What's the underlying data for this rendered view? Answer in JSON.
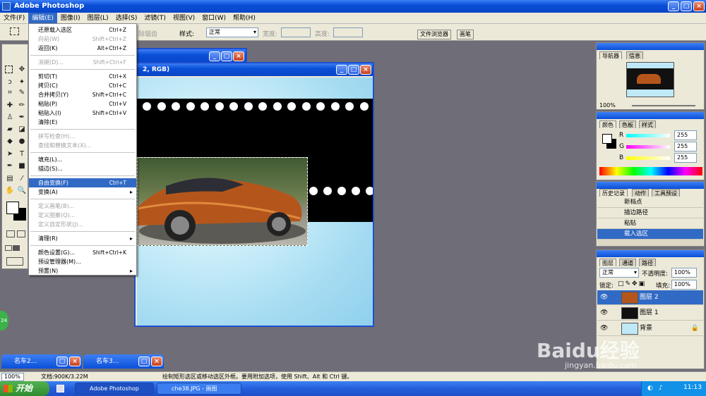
{
  "app": {
    "title": "Adobe Photoshop"
  },
  "menubar": [
    "文件(F)",
    "编辑(E)",
    "图像(I)",
    "图层(L)",
    "选择(S)",
    "滤镜(T)",
    "视图(V)",
    "窗口(W)",
    "帮助(H)"
  ],
  "options": {
    "feather_label": "除锯齿",
    "style_label": "样式:",
    "style_value": "正常",
    "width_label": "宽度:",
    "height_label": "高度:",
    "tabs": [
      "文件浏览器",
      "画笔"
    ]
  },
  "edit_menu": [
    {
      "label": "还原载入选区",
      "shortcut": "Ctrl+Z",
      "state": "normal"
    },
    {
      "label": "向前(W)",
      "shortcut": "Shift+Ctrl+Z",
      "state": "disabled"
    },
    {
      "label": "返回(K)",
      "shortcut": "Alt+Ctrl+Z",
      "state": "normal"
    },
    {
      "label": "消褪(D)...",
      "shortcut": "Shift+Ctrl+F",
      "state": "disabled"
    },
    {
      "label": "剪切(T)",
      "shortcut": "Ctrl+X",
      "state": "normal"
    },
    {
      "label": "拷贝(C)",
      "shortcut": "Ctrl+C",
      "state": "normal"
    },
    {
      "label": "合并拷贝(Y)",
      "shortcut": "Shift+Ctrl+C",
      "state": "normal"
    },
    {
      "label": "粘贴(P)",
      "shortcut": "Ctrl+V",
      "state": "normal"
    },
    {
      "label": "粘贴入(I)",
      "shortcut": "Shift+Ctrl+V",
      "state": "normal"
    },
    {
      "label": "清除(E)",
      "shortcut": "",
      "state": "normal"
    },
    {
      "label": "拼写检查(H)...",
      "shortcut": "",
      "state": "disabled"
    },
    {
      "label": "查找和替换文本(X)...",
      "shortcut": "",
      "state": "disabled"
    },
    {
      "label": "填充(L)...",
      "shortcut": "",
      "state": "normal"
    },
    {
      "label": "描边(S)...",
      "shortcut": "",
      "state": "normal"
    },
    {
      "label": "自由变换(F)",
      "shortcut": "Ctrl+T",
      "state": "highlight"
    },
    {
      "label": "变换(A)",
      "shortcut": "",
      "state": "submenu"
    },
    {
      "label": "定义画笔(B)...",
      "shortcut": "",
      "state": "disabled"
    },
    {
      "label": "定义图案(Q)...",
      "shortcut": "",
      "state": "disabled"
    },
    {
      "label": "定义自定形状(J)...",
      "shortcut": "",
      "state": "disabled"
    },
    {
      "label": "清理(R)",
      "shortcut": "",
      "state": "submenu"
    },
    {
      "label": "颜色设置(G)...",
      "shortcut": "Shift+Ctrl+K",
      "state": "normal"
    },
    {
      "label": "预设管理器(M)...",
      "shortcut": "",
      "state": "normal"
    },
    {
      "label": "预置(N)",
      "shortcut": "",
      "state": "submenu"
    }
  ],
  "document": {
    "title_fragment": "2, RGB)"
  },
  "navigator": {
    "tabs": [
      "导航器",
      "信息"
    ],
    "zoom": "100%"
  },
  "color": {
    "tabs": [
      "颜色",
      "色板",
      "样式"
    ],
    "r": "255",
    "g": "255",
    "b": "255",
    "r_label": "R",
    "g_label": "G",
    "b_label": "B"
  },
  "history": {
    "tabs": [
      "历史记录",
      "动作",
      "工具预设"
    ],
    "items": [
      "新档点",
      "描边路径",
      "粘贴",
      "载入选区"
    ]
  },
  "layers": {
    "tabs": [
      "图层",
      "通道",
      "路径"
    ],
    "blend_mode": "正常",
    "opacity_label": "不透明度:",
    "opacity": "100%",
    "lock_label": "锁定:",
    "fill_label": "填充:",
    "fill": "100%",
    "items": [
      "图层 2",
      "图层 1",
      "背景"
    ]
  },
  "minimized": [
    "名车2...",
    "名车3..."
  ],
  "status": {
    "zoom": "100%",
    "doc": "文档:900K/3.22M",
    "hint": "绘制矩形选区或移动选区外框。要用附加选项，使用 Shift、Alt 和 Ctrl 键。"
  },
  "taskbar": {
    "start": "开始",
    "items": [
      "Adobe Photoshop",
      "che38.JPG - 画图"
    ],
    "time": "11:13"
  },
  "side_badge": "24",
  "watermark": {
    "brand": "Baidu经验",
    "url": "jingyan.baidu.com"
  }
}
